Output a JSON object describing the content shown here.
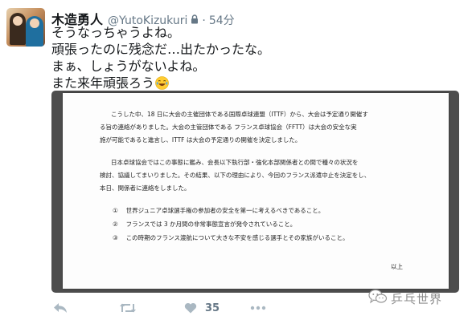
{
  "tweet": {
    "display_name": "木造勇人",
    "handle": "@YutoKizukuri",
    "separator": "·",
    "time": "54分",
    "text_lines": [
      "そうなっちゃうよね。",
      "頑張ったのに残念だ…出たかったな。",
      "まぁ、しょうがないよね。",
      "また来年頑張ろう"
    ],
    "emoji": "laughing-tears-emoji"
  },
  "document": {
    "lines": [
      "こうした中、18 日に大会の主催団体である国際卓球連盟（ITTF）から、大会は予定通り開催す",
      "る旨の連絡がありました。大会の主管団体である フランス卓球協会（FFTT）は大会の安全な実",
      "施が可能であると進言し、ITTF は大会の予定通りの開催を決定しました。",
      "日本卓球協会ではこの事態に鑑み、会長以下執行部・強化本部関係者との間で種々の状況を",
      "検討、協議してまいりました。その結果、以下の理由により、今回のフランス派遣中止を決定をし、",
      "本日、関係者に連絡をしました。",
      "①　 世界ジュニア卓球選手権の参加者の安全を第一に考えるべきであること。",
      "②　 フランスでは 3 か月間の非常事態宣言が発令されていること。",
      "③　 この時期のフランス渡航について大きな不安を感じる選手とその家族がいること。",
      "以上"
    ]
  },
  "actions": {
    "reply_icon": "reply-icon",
    "retweet_icon": "retweet-icon",
    "like_icon": "heart-icon",
    "like_count": "35",
    "more_icon": "more-icon"
  },
  "watermark": {
    "text": "乒乓世界",
    "icon": "wechat-icon"
  },
  "colors": {
    "text": "#14171a",
    "secondary": "#657786",
    "media_bg": "#4d4d4d",
    "action_icon": "#aab8c2"
  }
}
